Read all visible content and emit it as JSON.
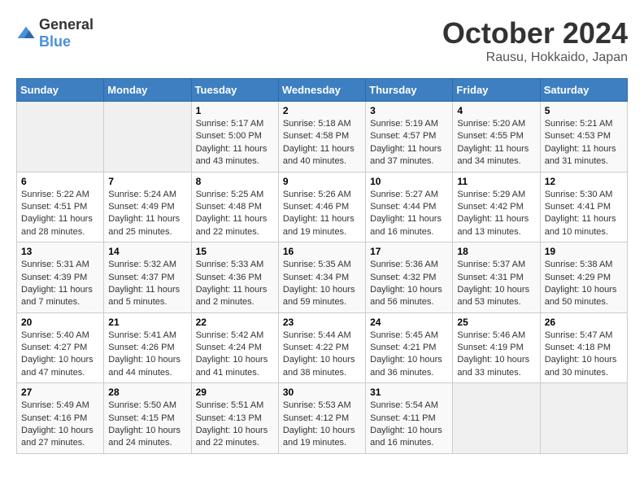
{
  "header": {
    "logo_general": "General",
    "logo_blue": "Blue",
    "month": "October 2024",
    "location": "Rausu, Hokkaido, Japan"
  },
  "days_of_week": [
    "Sunday",
    "Monday",
    "Tuesday",
    "Wednesday",
    "Thursday",
    "Friday",
    "Saturday"
  ],
  "weeks": [
    [
      {
        "day": "",
        "info": ""
      },
      {
        "day": "",
        "info": ""
      },
      {
        "day": "1",
        "info": "Sunrise: 5:17 AM\nSunset: 5:00 PM\nDaylight: 11 hours and 43 minutes."
      },
      {
        "day": "2",
        "info": "Sunrise: 5:18 AM\nSunset: 4:58 PM\nDaylight: 11 hours and 40 minutes."
      },
      {
        "day": "3",
        "info": "Sunrise: 5:19 AM\nSunset: 4:57 PM\nDaylight: 11 hours and 37 minutes."
      },
      {
        "day": "4",
        "info": "Sunrise: 5:20 AM\nSunset: 4:55 PM\nDaylight: 11 hours and 34 minutes."
      },
      {
        "day": "5",
        "info": "Sunrise: 5:21 AM\nSunset: 4:53 PM\nDaylight: 11 hours and 31 minutes."
      }
    ],
    [
      {
        "day": "6",
        "info": "Sunrise: 5:22 AM\nSunset: 4:51 PM\nDaylight: 11 hours and 28 minutes."
      },
      {
        "day": "7",
        "info": "Sunrise: 5:24 AM\nSunset: 4:49 PM\nDaylight: 11 hours and 25 minutes."
      },
      {
        "day": "8",
        "info": "Sunrise: 5:25 AM\nSunset: 4:48 PM\nDaylight: 11 hours and 22 minutes."
      },
      {
        "day": "9",
        "info": "Sunrise: 5:26 AM\nSunset: 4:46 PM\nDaylight: 11 hours and 19 minutes."
      },
      {
        "day": "10",
        "info": "Sunrise: 5:27 AM\nSunset: 4:44 PM\nDaylight: 11 hours and 16 minutes."
      },
      {
        "day": "11",
        "info": "Sunrise: 5:29 AM\nSunset: 4:42 PM\nDaylight: 11 hours and 13 minutes."
      },
      {
        "day": "12",
        "info": "Sunrise: 5:30 AM\nSunset: 4:41 PM\nDaylight: 11 hours and 10 minutes."
      }
    ],
    [
      {
        "day": "13",
        "info": "Sunrise: 5:31 AM\nSunset: 4:39 PM\nDaylight: 11 hours and 7 minutes."
      },
      {
        "day": "14",
        "info": "Sunrise: 5:32 AM\nSunset: 4:37 PM\nDaylight: 11 hours and 5 minutes."
      },
      {
        "day": "15",
        "info": "Sunrise: 5:33 AM\nSunset: 4:36 PM\nDaylight: 11 hours and 2 minutes."
      },
      {
        "day": "16",
        "info": "Sunrise: 5:35 AM\nSunset: 4:34 PM\nDaylight: 10 hours and 59 minutes."
      },
      {
        "day": "17",
        "info": "Sunrise: 5:36 AM\nSunset: 4:32 PM\nDaylight: 10 hours and 56 minutes."
      },
      {
        "day": "18",
        "info": "Sunrise: 5:37 AM\nSunset: 4:31 PM\nDaylight: 10 hours and 53 minutes."
      },
      {
        "day": "19",
        "info": "Sunrise: 5:38 AM\nSunset: 4:29 PM\nDaylight: 10 hours and 50 minutes."
      }
    ],
    [
      {
        "day": "20",
        "info": "Sunrise: 5:40 AM\nSunset: 4:27 PM\nDaylight: 10 hours and 47 minutes."
      },
      {
        "day": "21",
        "info": "Sunrise: 5:41 AM\nSunset: 4:26 PM\nDaylight: 10 hours and 44 minutes."
      },
      {
        "day": "22",
        "info": "Sunrise: 5:42 AM\nSunset: 4:24 PM\nDaylight: 10 hours and 41 minutes."
      },
      {
        "day": "23",
        "info": "Sunrise: 5:44 AM\nSunset: 4:22 PM\nDaylight: 10 hours and 38 minutes."
      },
      {
        "day": "24",
        "info": "Sunrise: 5:45 AM\nSunset: 4:21 PM\nDaylight: 10 hours and 36 minutes."
      },
      {
        "day": "25",
        "info": "Sunrise: 5:46 AM\nSunset: 4:19 PM\nDaylight: 10 hours and 33 minutes."
      },
      {
        "day": "26",
        "info": "Sunrise: 5:47 AM\nSunset: 4:18 PM\nDaylight: 10 hours and 30 minutes."
      }
    ],
    [
      {
        "day": "27",
        "info": "Sunrise: 5:49 AM\nSunset: 4:16 PM\nDaylight: 10 hours and 27 minutes."
      },
      {
        "day": "28",
        "info": "Sunrise: 5:50 AM\nSunset: 4:15 PM\nDaylight: 10 hours and 24 minutes."
      },
      {
        "day": "29",
        "info": "Sunrise: 5:51 AM\nSunset: 4:13 PM\nDaylight: 10 hours and 22 minutes."
      },
      {
        "day": "30",
        "info": "Sunrise: 5:53 AM\nSunset: 4:12 PM\nDaylight: 10 hours and 19 minutes."
      },
      {
        "day": "31",
        "info": "Sunrise: 5:54 AM\nSunset: 4:11 PM\nDaylight: 10 hours and 16 minutes."
      },
      {
        "day": "",
        "info": ""
      },
      {
        "day": "",
        "info": ""
      }
    ]
  ]
}
